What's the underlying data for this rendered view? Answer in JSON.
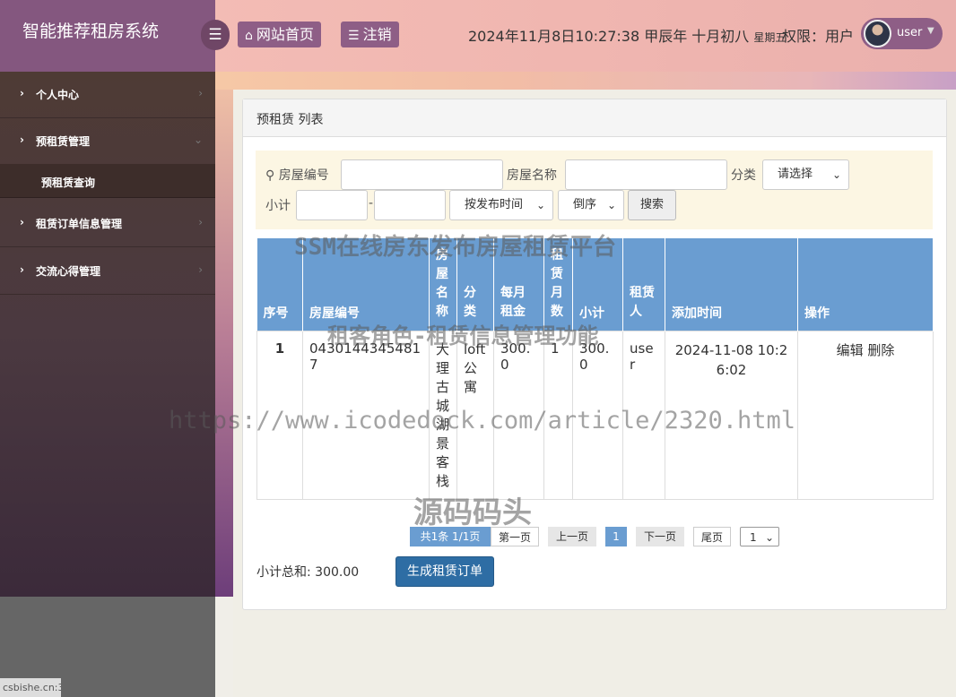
{
  "app": {
    "title": "智能推荐租房系统"
  },
  "header": {
    "home_label": "网站首页",
    "logout_label": "注销",
    "datetime": "2024年11月8日10:27:38 甲辰年 十月初八",
    "weekday": "星期五",
    "permission": "权限：用户",
    "username": "user",
    "icons": {
      "menu": "hamburger-icon",
      "home": "home-icon",
      "logout": "list-icon",
      "user_caret": "caret-down-icon"
    }
  },
  "sidebar": {
    "items": [
      {
        "label": "个人中心"
      },
      {
        "label": "预租赁管理"
      },
      {
        "label": "租赁订单信息管理"
      },
      {
        "label": "交流心得管理"
      }
    ],
    "submenu": [
      {
        "label": "预租赁查询"
      }
    ],
    "footer_note": "csbishe.cn:3"
  },
  "panel": {
    "title": "预租赁 列表"
  },
  "search": {
    "house_no_label": "房屋编号",
    "house_name_label": "房屋名称",
    "category_label": "分类",
    "category_selected": "请选择",
    "subtotal_label": "小计",
    "range_sep": "-",
    "sort_field": "按发布时间",
    "sort_order": "倒序",
    "search_button": "搜索"
  },
  "table": {
    "headers": [
      "序号",
      "房屋编号",
      "房屋名称",
      "分类",
      "每月租金",
      "租赁月数",
      "小计",
      "租赁人",
      "添加时间",
      "操作"
    ],
    "rows": [
      {
        "index": "1",
        "house_no": "04301443454817",
        "house_name": "大理古城湖景客栈",
        "category": "loft公寓",
        "monthly_rent": "300.0",
        "months": "1",
        "subtotal": "300.0",
        "tenant": "user",
        "added_time": "2024-11-08 10:26:02",
        "edit": "编辑",
        "delete": "删除"
      }
    ]
  },
  "pagination": {
    "total": "共1条  1/1页",
    "first": "第一页",
    "prev": "上一页",
    "current": "1",
    "next": "下一页",
    "last": "尾页",
    "page_select": "1"
  },
  "footer": {
    "subtotal_sum": "小计总和: 300.00",
    "order_button": "生成租赁订单"
  },
  "watermarks": {
    "line1": "SSM在线房东发布房屋租赁平台",
    "line2": "租客角色-租赁信息管理功能",
    "line3": "https://www.icodedock.com/article/2320.html",
    "line4": "源码码头"
  }
}
